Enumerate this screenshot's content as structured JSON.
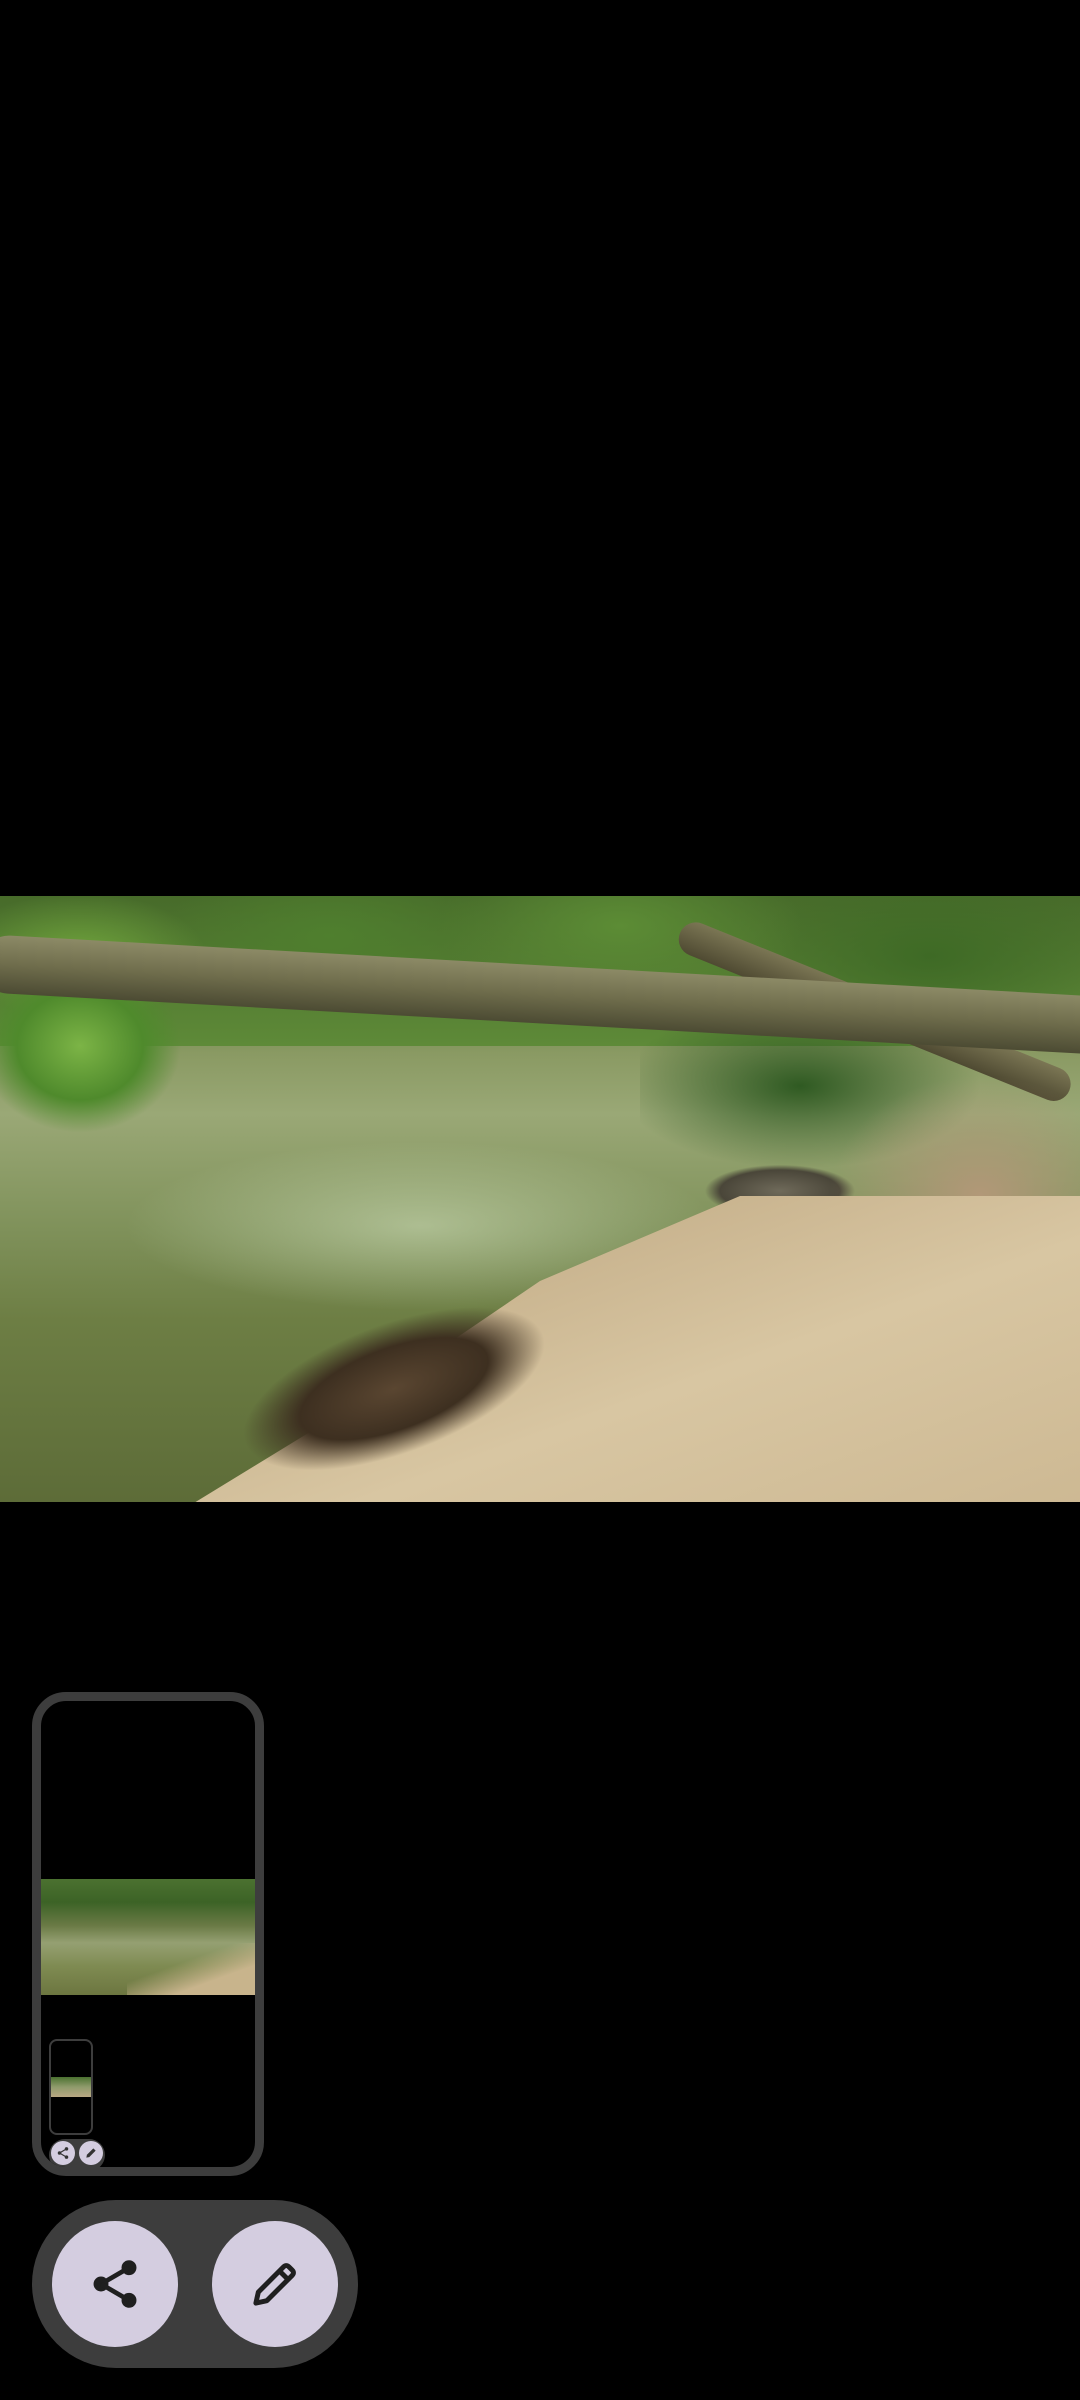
{
  "viewer": {
    "photo_description_icon": "river-photo",
    "background_color": "#000000"
  },
  "recents": {
    "thumbnail_icon": "screenshot-thumbnail"
  },
  "actions": {
    "share_icon": "share-icon",
    "edit_icon": "edit-pencil-icon",
    "button_color": "#d4cde0",
    "pill_color": "#3d3d3d"
  }
}
